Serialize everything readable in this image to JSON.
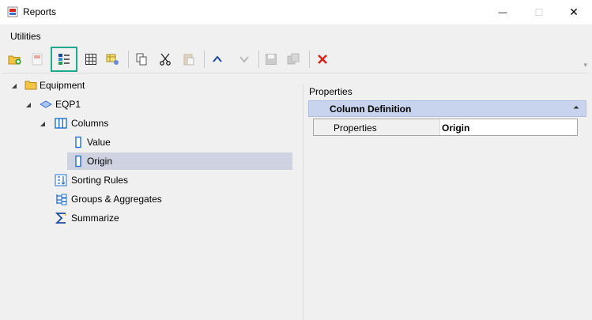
{
  "window": {
    "title": "Reports",
    "minimize_glyph": "—",
    "maximize_glyph": "☐",
    "close_glyph": "✕"
  },
  "menu": {
    "items": [
      "Utilities"
    ]
  },
  "toolbar": {
    "buttons": [
      {
        "icon": "add-folder-icon",
        "enabled": true
      },
      {
        "icon": "report-icon",
        "enabled": false
      },
      {
        "icon": "column-definition-icon",
        "enabled": true,
        "highlighted": true
      },
      {
        "icon": "grid-icon",
        "enabled": true
      },
      {
        "icon": "table-edit-icon",
        "enabled": true
      },
      {
        "icon": "copy-icon",
        "enabled": true
      },
      {
        "icon": "cut-icon",
        "enabled": true
      },
      {
        "icon": "paste-icon",
        "enabled": false
      },
      {
        "icon": "move-up-icon",
        "enabled": true
      },
      {
        "icon": "move-down-icon",
        "enabled": false
      },
      {
        "icon": "save-icon",
        "enabled": false
      },
      {
        "icon": "save-all-icon",
        "enabled": false
      },
      {
        "icon": "delete-icon",
        "enabled": true
      }
    ],
    "overflow_glyph": "▾"
  },
  "tree": {
    "expander_glyph": "◢",
    "nodes": [
      {
        "label": "Equipment",
        "icon": "folder-icon",
        "expanded": true
      },
      {
        "label": "EQP1",
        "icon": "report-node-icon",
        "expanded": true
      },
      {
        "label": "Columns",
        "icon": "columns-icon",
        "expanded": true
      },
      {
        "label": "Value",
        "icon": "column-icon"
      },
      {
        "label": "Origin",
        "icon": "column-icon",
        "selected": true
      },
      {
        "label": "Sorting Rules",
        "icon": "sorting-icon"
      },
      {
        "label": "Groups & Aggregates",
        "icon": "groups-icon"
      },
      {
        "label": "Summarize",
        "icon": "sigma-icon"
      }
    ]
  },
  "properties": {
    "title": "Properties",
    "section_label": "Column Definition",
    "collapse_glyph": "⏶",
    "rows": [
      {
        "key": "Properties",
        "value": "Origin"
      }
    ]
  },
  "colors": {
    "accent_highlight": "#1ea88c",
    "selection": "#cfd2e1",
    "section_header": "#c8d4ee",
    "delete_red": "#d9261c",
    "arrow_blue": "#1f4a9c"
  }
}
